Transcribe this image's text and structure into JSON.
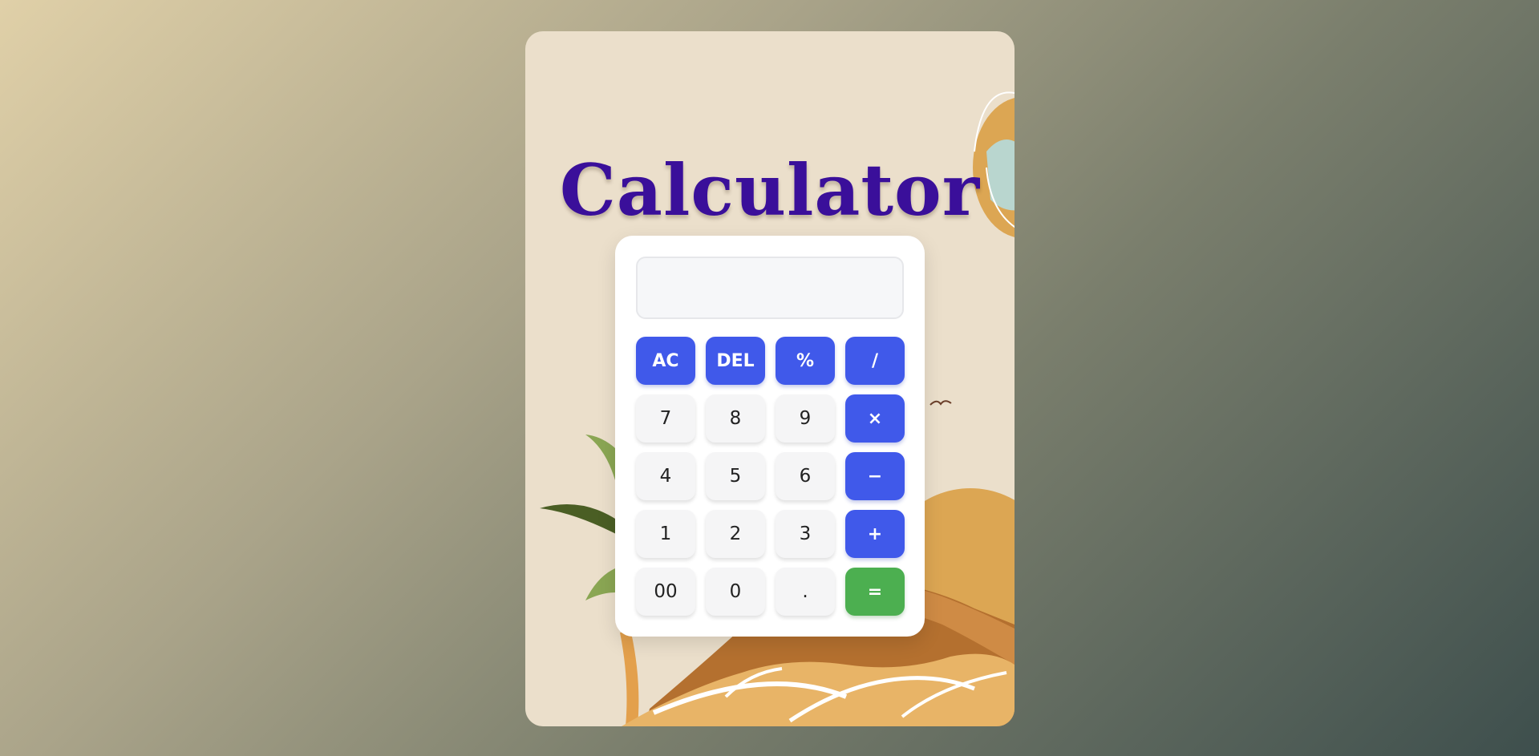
{
  "app": {
    "title": "Calculator"
  },
  "display": {
    "value": ""
  },
  "keys": {
    "ac": "AC",
    "del": "DEL",
    "percent": "%",
    "divide": "/",
    "seven": "7",
    "eight": "8",
    "nine": "9",
    "multiply": "×",
    "four": "4",
    "five": "5",
    "six": "6",
    "minus": "−",
    "one": "1",
    "two": "2",
    "three": "3",
    "plus": "+",
    "double_zero": "00",
    "zero": "0",
    "dot": ".",
    "equals": "="
  },
  "colors": {
    "operator": "#4059ea",
    "equals": "#4caf50",
    "title": "#3a0f9a",
    "card_background": "#ebdfcb"
  },
  "decorations": [
    "hot-air-balloon",
    "bird",
    "palm-tree",
    "sun",
    "desert-mountains"
  ]
}
